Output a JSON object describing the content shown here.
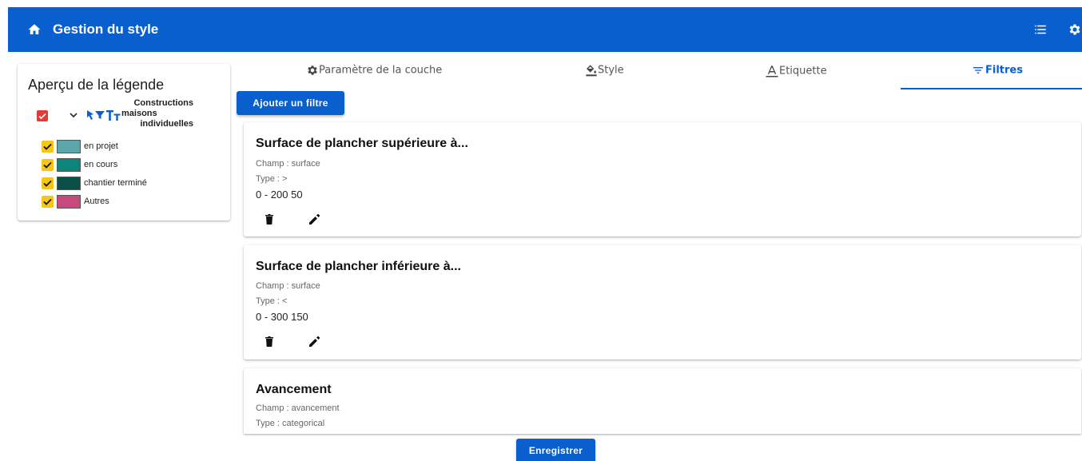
{
  "header": {
    "title": "Gestion du style"
  },
  "legend": {
    "title": "Aperçu de la légende",
    "layer_name_line1": "Constructions",
    "layer_name_line2": "maisons",
    "layer_name_line3": "individuelles",
    "items": [
      {
        "label": "en projet",
        "color": "#5aa6a8"
      },
      {
        "label": "en cours",
        "color": "#0d857b"
      },
      {
        "label": "chantier terminé",
        "color": "#0b4f48"
      },
      {
        "label": "Autres",
        "color": "#c9487e"
      }
    ]
  },
  "tabs": [
    {
      "label": "Paramètre de la couche",
      "icon": "gear-icon"
    },
    {
      "label": "Style",
      "icon": "paint-bucket-icon"
    },
    {
      "label": "Etiquette",
      "icon": "text-icon"
    },
    {
      "label": "Filtres",
      "icon": "filter-icon",
      "active": true
    }
  ],
  "add_filter_label": "Ajouter un filtre",
  "filters": [
    {
      "title": "Surface de plancher supérieure à...",
      "champ": "Champ : surface",
      "type": "Type : >",
      "value": "0 - 200 50"
    },
    {
      "title": "Surface de plancher inférieure à...",
      "champ": "Champ : surface",
      "type": "Type : <",
      "value": "0 - 300 150"
    },
    {
      "title": "Avancement",
      "champ": "Champ : avancement",
      "type": "Type : categorical"
    }
  ],
  "save_label": "Enregistrer",
  "colors": {
    "primary": "#0a5fcf",
    "layer_check": "#e53935",
    "item_check": "#f5c518"
  }
}
